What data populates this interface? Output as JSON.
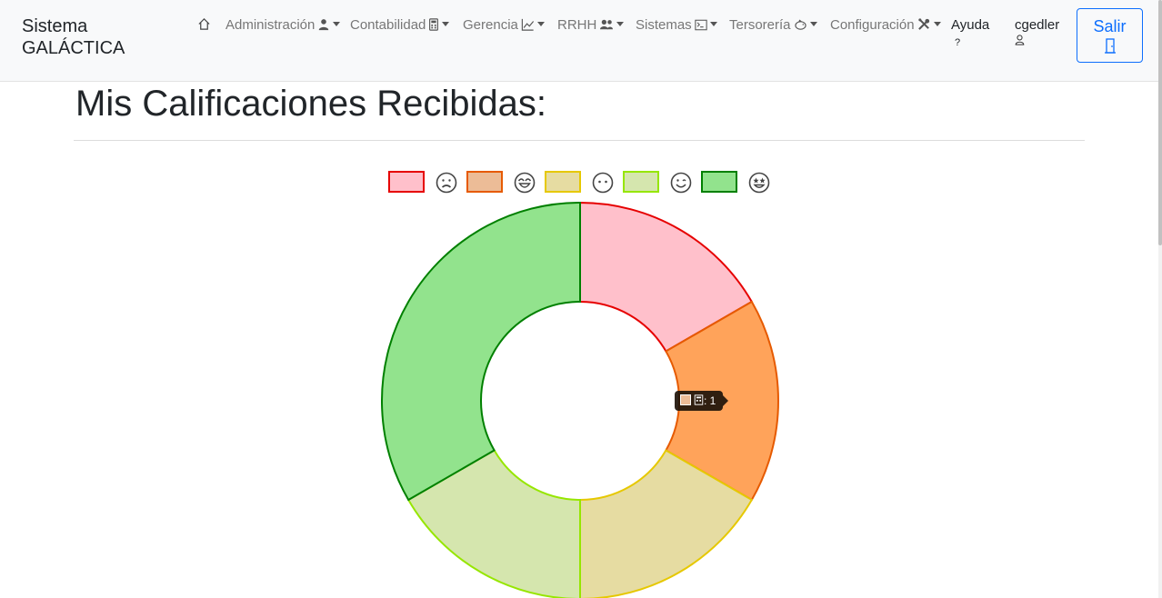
{
  "brand": {
    "line1": "Sistema",
    "line2": "GALÁCTICA"
  },
  "nav": {
    "items": [
      {
        "label": "Administración",
        "icon": "user-tie-icon"
      },
      {
        "label": "Contabilidad",
        "icon": "calculator-icon"
      },
      {
        "label": "Gerencia",
        "icon": "chart-line-icon"
      },
      {
        "label": "RRHH",
        "icon": "people-icon"
      },
      {
        "label": "Sistemas",
        "icon": "terminal-icon"
      },
      {
        "label": "Tersorería",
        "icon": "piggy-bank-icon"
      },
      {
        "label": "Configuración",
        "icon": "tools-icon"
      }
    ],
    "help": {
      "label": "Ayuda",
      "sub": "?"
    },
    "user": {
      "label": "cgedler",
      "icon": "person-icon"
    },
    "logout": {
      "label": "Salir",
      "icon": "door-icon"
    }
  },
  "page": {
    "title": "Mis Calificaciones Recibidas:"
  },
  "chart_data": {
    "type": "pie",
    "variant": "doughnut",
    "categories": [
      "frown",
      "grin-beam",
      "neutral",
      "smile",
      "star-struck"
    ],
    "values": [
      1,
      1,
      1,
      1,
      2
    ],
    "colors": {
      "fill": [
        "#ffc0cb",
        "#ffa35a",
        "#e6dca2",
        "#d5e6ae",
        "#92e38d"
      ],
      "legend_fill": [
        "#ffc0cb",
        "#ecbc97",
        "#e6dca2",
        "#d5e6ae",
        "#92e38d"
      ],
      "border": [
        "#e60000",
        "#e65a00",
        "#e6c800",
        "#96e600",
        "#008000"
      ]
    },
    "legend_position": "top",
    "tooltip": {
      "category": "calculator",
      "value": "1",
      "text": ": 1"
    }
  }
}
